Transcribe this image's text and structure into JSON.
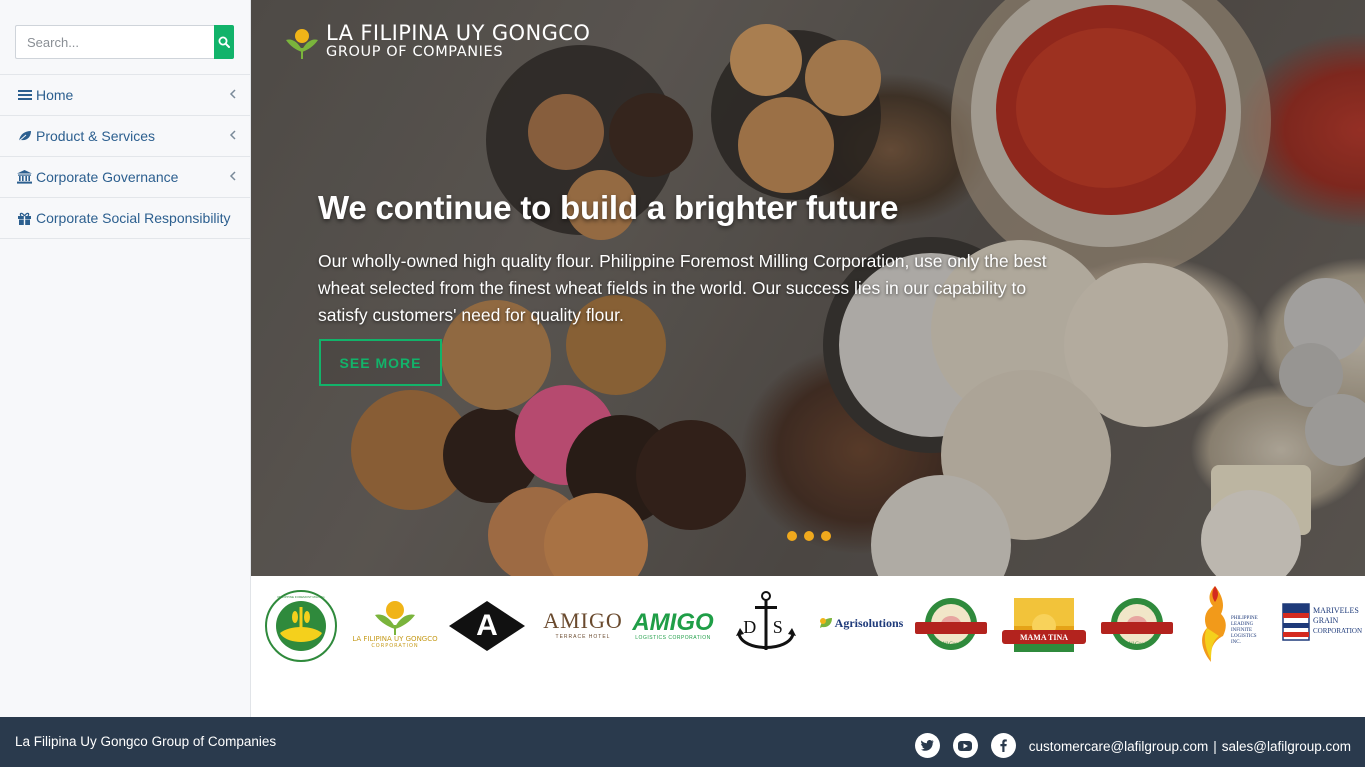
{
  "search": {
    "placeholder": "Search...",
    "button_icon": "search-icon"
  },
  "sidebar": {
    "items": [
      {
        "label": "Home",
        "icon": "bars-icon"
      },
      {
        "label": "Product & Services",
        "icon": "leaf-icon"
      },
      {
        "label": "Corporate Governance",
        "icon": "bank-icon"
      },
      {
        "label": "Corporate Social Responsibility",
        "icon": "gift-icon"
      }
    ]
  },
  "hero": {
    "logo_title": "LA FILIPINA UY GONGCO",
    "logo_subtitle": "GROUP OF COMPANIES",
    "title": "We continue to build a brighter future",
    "text": "Our wholly-owned high quality flour. Philippine Foremost Milling Corporation, use only the best wheat selected from the finest wheat fields in the world. Our success lies in our capability to satisfy customers' need for quality flour.",
    "button_label": "SEE MORE",
    "slide_count": 3
  },
  "brands": {
    "pfmc_ring": "PHILIPPINE FOREMOST MILLING CORPORATION",
    "lfug_name": "LA FILIPINA UY GONGCO",
    "lfug_sub": "CORPORATION",
    "a_letter": "A",
    "amigo_name": "AMIGO",
    "amigo_sub": "TERRACE HOTEL",
    "amigo_logistics": "AMIGO",
    "amigo_logistics_sub": "LOGISTICS CORPORATION",
    "ds": "D S",
    "agrisolutions": "Agrisolutions",
    "farm1_sub": "All Good",
    "mama_tina": "MAMA TINA",
    "farm2_sub": "All Good",
    "plilc": "PHILIPPINE LEADING INFINITE LOGISTICS INC.",
    "mgc_1": "MARIVELES",
    "mgc_2": "GRAIN",
    "mgc_3": "CORPORATION"
  },
  "footer": {
    "company": "La Filipina Uy Gongco Group of Companies",
    "email_1": "customercare@lafilgroup.com",
    "separator": "|",
    "email_2": "sales@lafilgroup.com",
    "social": [
      "twitter-icon",
      "youtube-icon",
      "facebook-icon"
    ]
  },
  "colors": {
    "accent_green": "#12b36a",
    "nav_text": "#2c5f8f",
    "footer_bg": "#2a3a4d",
    "dot_active": "#f0a91d"
  }
}
